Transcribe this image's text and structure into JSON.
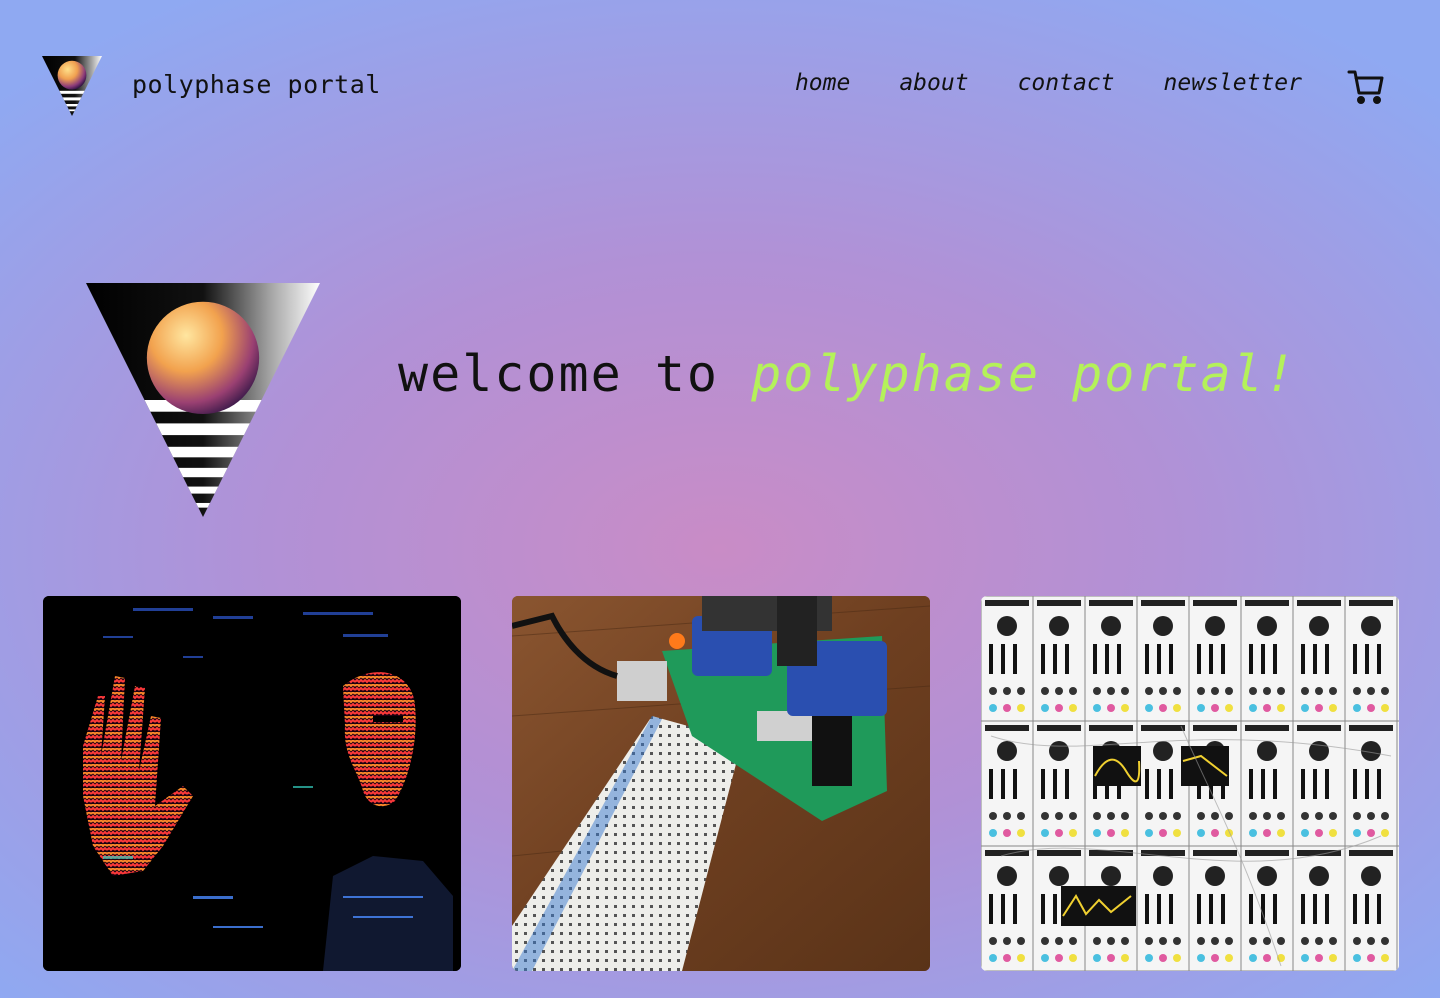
{
  "header": {
    "site_name": "polyphase portal",
    "nav": [
      {
        "label": "home"
      },
      {
        "label": "about"
      },
      {
        "label": "contact"
      },
      {
        "label": "newsletter"
      }
    ],
    "cart_icon": "shopping-cart-icon"
  },
  "hero": {
    "title_prefix": "welcome to ",
    "title_accent": "polyphase portal!",
    "accent_color": "#b4f15a"
  },
  "gallery": {
    "items": [
      {
        "icon": "glitch-portrait-image"
      },
      {
        "icon": "breadboard-circuit-image"
      },
      {
        "icon": "modular-synth-image"
      }
    ]
  },
  "colors": {
    "background_center": "#c98cc6",
    "background_edge": "#8fa9f2",
    "text": "#111111"
  }
}
